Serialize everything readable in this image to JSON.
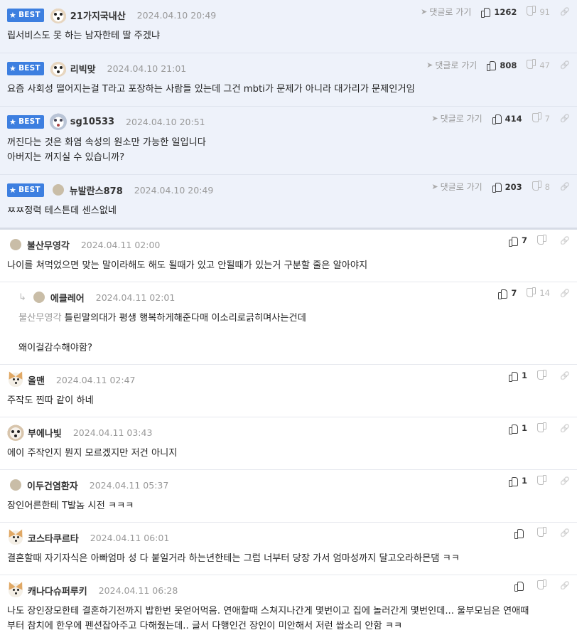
{
  "labels": {
    "best": "BEST",
    "reply_link": "댓글로 가기"
  },
  "best": [
    {
      "nick": "21가지국내산",
      "date": "2024.04.10 20:49",
      "up": "1262",
      "down": "91",
      "avatar": "dog",
      "lines": [
        "립서비스도 못 하는 남자한테 딸 주겠냐"
      ]
    },
    {
      "nick": "리빅맞",
      "date": "2024.04.10 21:01",
      "up": "808",
      "down": "47",
      "avatar": "dog",
      "lines": [
        "요즘 사회성 떨어지는걸 T라고 포장하는 사람들 있는데 그건 mbti가 문제가 아니라 대가리가 문제인거임"
      ]
    },
    {
      "nick": "sg10533",
      "date": "2024.04.10 20:51",
      "up": "414",
      "down": "7",
      "avatar": "sp",
      "lines": [
        "꺼진다는 것은 화염 속성의 원소만 가능한 일입니다",
        "아버지는 꺼지실 수 있습니까?"
      ]
    },
    {
      "nick": "뉴발란스878",
      "date": "2024.04.10 20:49",
      "up": "203",
      "down": "8",
      "avatar": "dot",
      "lines": [
        "ㅉㅉ정력 테스튼데 센스없네"
      ]
    }
  ],
  "comments": [
    {
      "nick": "불산무영각",
      "date": "2024.04.11 02:00",
      "up": "7",
      "down": "",
      "avatar": "dot",
      "lines": [
        "나이를 쳐먹었으면 맞는 말이라해도 해도 될때가 있고 안될때가 있는거 구분할 줄은 알아야지"
      ]
    },
    {
      "nick": "에클레어",
      "date": "2024.04.11 02:01",
      "up": "7",
      "down": "14",
      "avatar": "dot",
      "reply": true,
      "mention": "불산무영각",
      "lines": [
        "틀린말의대가 평생 행복하게해준다매 이소리로긁히며사는건데",
        "",
        "왜이걸감수해야함?"
      ]
    },
    {
      "nick": "올맨",
      "date": "2024.04.11 02:47",
      "up": "1",
      "down": "",
      "avatar": "chi",
      "lines": [
        "주작도 찐따 같이 하네"
      ]
    },
    {
      "nick": "부에나빛",
      "date": "2024.04.11 03:43",
      "up": "1",
      "down": "",
      "avatar": "dog2",
      "lines": [
        "에이 주작인지 뭔지 모르겠지만 저건 아니지"
      ]
    },
    {
      "nick": "이두건염환자",
      "date": "2024.04.11 05:37",
      "up": "1",
      "down": "",
      "avatar": "dot",
      "lines": [
        "장인어른한테 T발놈 시전 ㅋㅋㅋ"
      ]
    },
    {
      "nick": "코스타쿠르타",
      "date": "2024.04.11 06:01",
      "up": "",
      "down": "",
      "avatar": "chi",
      "lines": [
        "결혼할때 자기자식은 아빠엄마 성 다 붙일거라 하는년한테는 그럼 너부터 당장 가서 엄마성까지 달고오라하믄댐 ㅋㅋ"
      ]
    },
    {
      "nick": "캐나다슈퍼루키",
      "date": "2024.04.11 06:28",
      "up": "",
      "down": "",
      "avatar": "chi",
      "lines": [
        "나도 장인장모한테 결혼하기전까지 밥한번 못얻어먹음. 연애할때 스쳐지나간게 몇번이고 집에 놀러간게 몇번인데... 울부모님은 연애때",
        "부터 참치에 한우에 펜션잡아주고 다해줬는데.. 글서 다행인건 장인이 미안해서 저런 쌉소리 안함 ㅋㅋ"
      ]
    }
  ]
}
